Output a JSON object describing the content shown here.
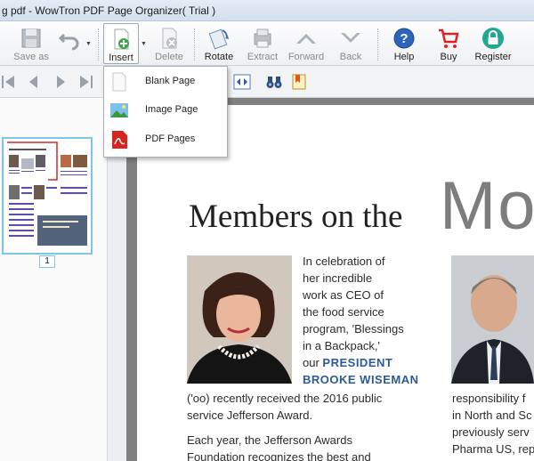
{
  "window": {
    "title": "g pdf - WowTron PDF Page Organizer( Trial )"
  },
  "toolbar": {
    "save_as": "Save as",
    "insert": "Insert",
    "delete": "Delete",
    "rotate": "Rotate",
    "extract": "Extract",
    "forward": "Forward",
    "back": "Back",
    "help": "Help",
    "buy": "Buy",
    "register": "Register"
  },
  "insert_menu": {
    "items": [
      {
        "label": "Blank Page",
        "icon": "blank-page-icon"
      },
      {
        "label": "Image Page",
        "icon": "image-page-icon"
      },
      {
        "label": "PDF Pages",
        "icon": "pdf-pages-icon"
      }
    ]
  },
  "thumbnails": {
    "page_number": "1"
  },
  "document": {
    "headline": "Members on the",
    "big_word": "Mo",
    "col1": [
      "In celebration of",
      "her incredible",
      "work as CEO of",
      "the food service",
      "program, 'Blessings",
      "in a Backpack,'",
      "our"
    ],
    "highlight1": "PRESIDENT",
    "highlight2": "BROOKE WISEMAN",
    "para1": [
      "('oo) recently received the 2016 public",
      "service Jefferson Award."
    ],
    "para2": [
      "Each year, the Jefferson Awards",
      "Foundation recognizes the best and"
    ],
    "col2": [
      "responsibility f",
      "in North and Sc",
      "previously serv",
      "Pharma US, rep"
    ]
  },
  "colors": {
    "accent_blue": "#2d5a93",
    "selection": "#7cc7e6",
    "viewer_bg": "#808080"
  }
}
